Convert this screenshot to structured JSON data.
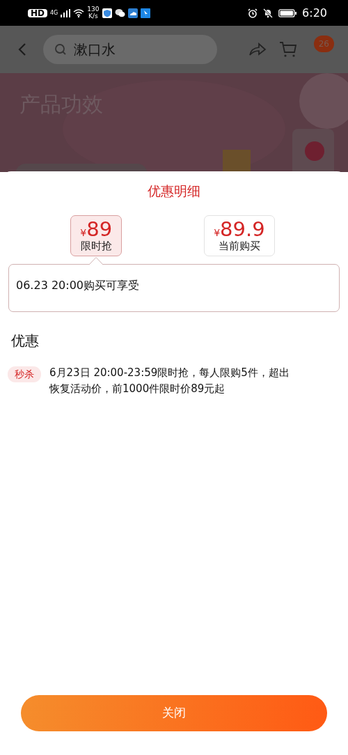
{
  "status_bar": {
    "hd": "HD",
    "network": "4G",
    "speed": "130",
    "speed_unit": "K/s",
    "time": "6:20"
  },
  "nav": {
    "search": {
      "placeholder": "漱口水"
    },
    "cart_badge": "26"
  },
  "banner": {
    "title": "产品功效"
  },
  "sheet": {
    "title": "优惠明细",
    "price_options": [
      {
        "currency": "¥",
        "price": "89",
        "label": "限时抢",
        "selected": true
      },
      {
        "currency": "¥",
        "price": "89.9",
        "label": "当前购买",
        "selected": false
      }
    ],
    "tooltip": "06.23 20:00购买可享受",
    "section_title": "优惠",
    "promotions": [
      {
        "tag": "秒杀",
        "text": "6月23日 20:00-23:59限时抢，每人限购5件，超出恢复活动价，前1000件限时价89元起"
      }
    ],
    "close_button": "关闭"
  }
}
